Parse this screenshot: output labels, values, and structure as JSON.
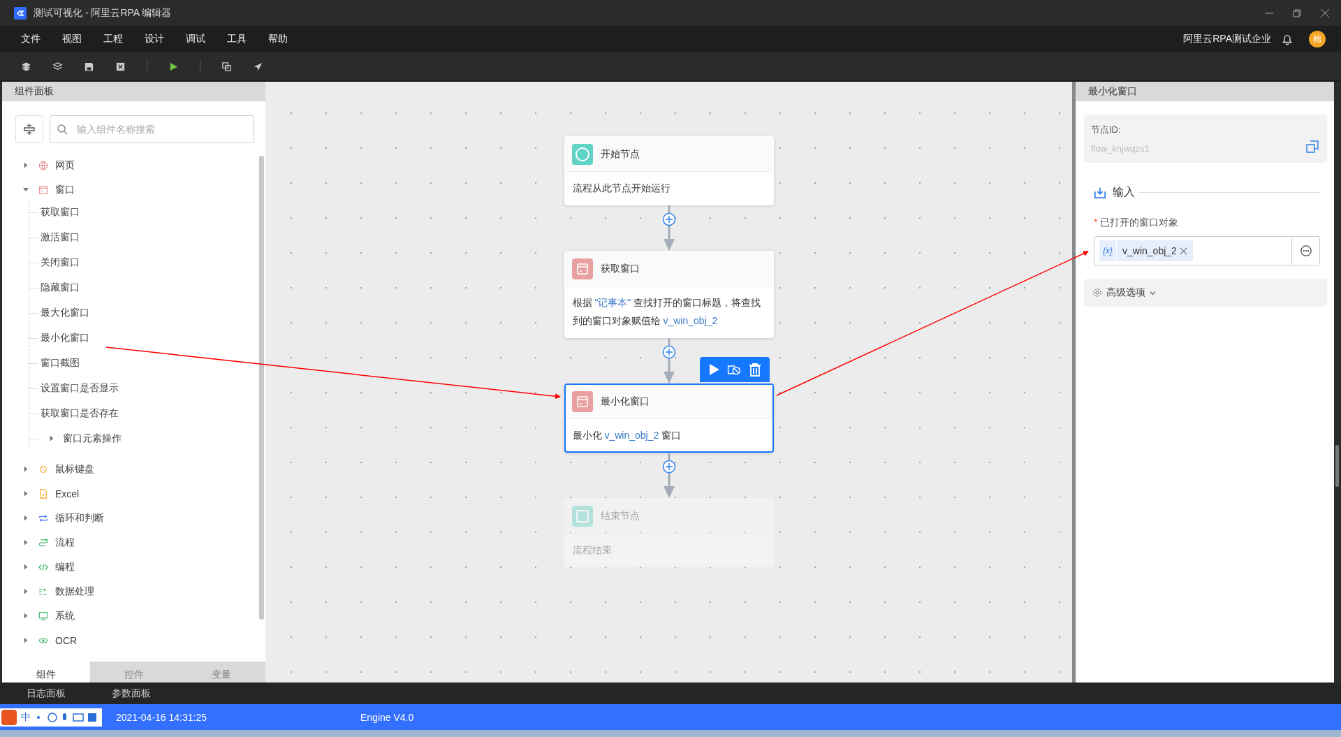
{
  "window": {
    "title": "测试可视化 - 阿里云RPA 编辑器"
  },
  "menu": [
    "文件",
    "视图",
    "工程",
    "设计",
    "调试",
    "工具",
    "帮助"
  ],
  "account": {
    "organization": "阿里云RPA测试企业",
    "avatar": "棉"
  },
  "left_panel": {
    "title": "组件面板",
    "search": {
      "placeholder": "输入组件名称搜索"
    },
    "tree": [
      {
        "label": "网页",
        "expanded": false
      },
      {
        "label": "窗口",
        "expanded": true,
        "children": [
          {
            "label": "获取窗口"
          },
          {
            "label": "激活窗口"
          },
          {
            "label": "关闭窗口"
          },
          {
            "label": "隐藏窗口"
          },
          {
            "label": "最大化窗口"
          },
          {
            "label": "最小化窗口"
          },
          {
            "label": "窗口截图"
          },
          {
            "label": "设置窗口是否显示"
          },
          {
            "label": "获取窗口是否存在"
          },
          {
            "label": "窗口元素操作",
            "expanded": false
          }
        ]
      },
      {
        "label": "鼠标键盘",
        "expanded": false
      },
      {
        "label": "Excel",
        "expanded": false
      },
      {
        "label": "循环和判断",
        "expanded": false
      },
      {
        "label": "流程",
        "expanded": false
      },
      {
        "label": "编程",
        "expanded": false
      },
      {
        "label": "数据处理",
        "expanded": false
      },
      {
        "label": "系统",
        "expanded": false
      },
      {
        "label": "OCR",
        "expanded": false
      }
    ],
    "tabs": [
      {
        "label": "组件",
        "selected": true
      },
      {
        "label": "控件",
        "selected": false
      },
      {
        "label": "变量",
        "selected": false
      }
    ]
  },
  "flow": {
    "nodes": [
      {
        "kind": "start",
        "title": "开始节点",
        "selected": false,
        "disabled": false,
        "description": [
          {
            "text": "流程从此节点开始运行",
            "kind": "text"
          }
        ]
      },
      {
        "kind": "action",
        "title": "获取窗口",
        "selected": false,
        "disabled": false,
        "description": [
          {
            "text": "根据 ",
            "kind": "text"
          },
          {
            "text": "\"记事本\"",
            "kind": "var"
          },
          {
            "text": " 查找打开的窗口标题，将查找到的窗口对象赋值给 ",
            "kind": "text"
          },
          {
            "text": "v_win_obj_2",
            "kind": "var"
          }
        ]
      },
      {
        "kind": "action",
        "title": "最小化窗口",
        "selected": true,
        "disabled": false,
        "description": [
          {
            "text": "最小化 ",
            "kind": "text"
          },
          {
            "text": "v_win_obj_2",
            "kind": "var"
          },
          {
            "text": " 窗口",
            "kind": "text"
          }
        ]
      },
      {
        "kind": "end",
        "title": "结束节点",
        "selected": false,
        "disabled": true,
        "description": [
          {
            "text": "流程结束",
            "kind": "text"
          }
        ]
      }
    ]
  },
  "right_panel": {
    "title": "最小化窗口",
    "node_id_label": "节点ID:",
    "node_id": "flow_knjwqzs1",
    "section": "输入",
    "field": {
      "label": "已打开的窗口对象",
      "required_mark": "*",
      "chip_prefix": "{x}",
      "value": "v_win_obj_2"
    },
    "advanced": "高级选项"
  },
  "bottom_tabs": [
    "日志面板",
    "参数面板"
  ],
  "status_bar": {
    "ime": "中",
    "saved_time": "2021-04-16 14:31:25",
    "engine": "Engine V4.0"
  }
}
